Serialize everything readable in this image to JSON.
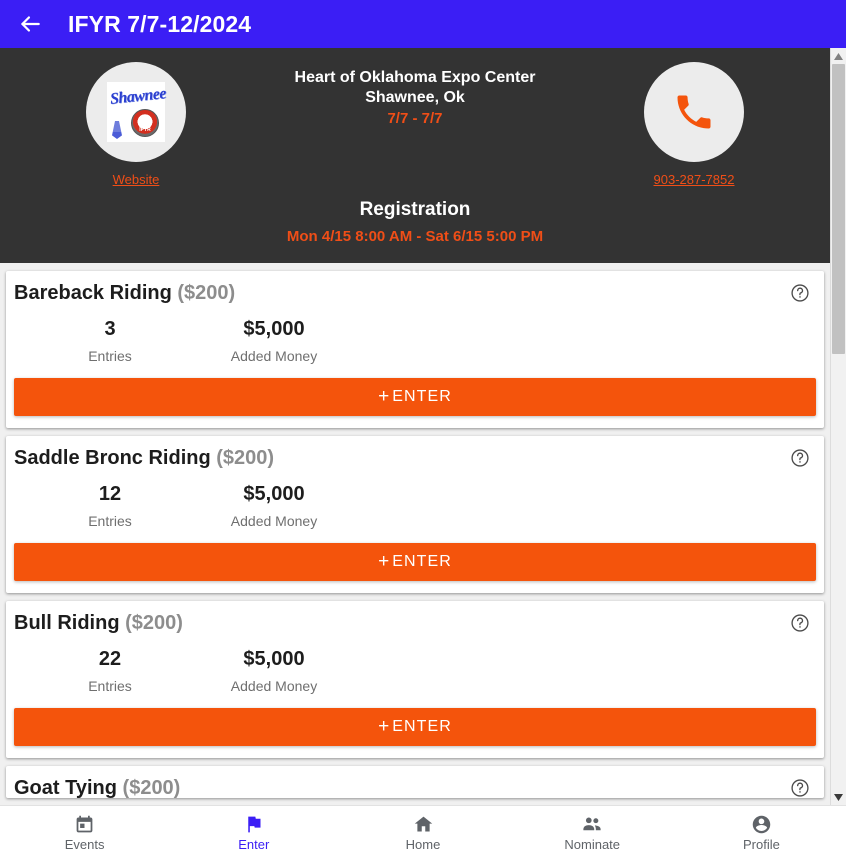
{
  "appbar": {
    "back_icon": "arrow-left-icon",
    "title": "IFYR 7/7-12/2024",
    "background_color": "#3b1ef5"
  },
  "event_header": {
    "background_color": "#333333",
    "accent_color": "#f04e17",
    "logo": {
      "icon": "shawnee-ifyr-logo",
      "text": "Shawnee",
      "emblem_text": "IFYR"
    },
    "website_link": "Website",
    "venue_name": "Heart of Oklahoma Expo Center",
    "venue_city": "Shawnee, Ok",
    "venue_dates": "7/7 - 7/7",
    "phone_icon": "phone-icon",
    "phone_number": "903-287-7852",
    "registration_title": "Registration",
    "registration_window": "Mon 4/15 8:00 AM - Sat 6/15 5:00 PM"
  },
  "cards": {
    "entries_label": "Entries",
    "added_money_label": "Added Money",
    "enter_label": "ENTER",
    "enter_plus": "+",
    "help_icon": "help-circle-icon",
    "button_color": "#f4540c",
    "items": [
      {
        "title": "Bareback Riding",
        "fee": "($200)",
        "entries": "3",
        "added_money": "$5,000"
      },
      {
        "title": "Saddle Bronc Riding",
        "fee": "($200)",
        "entries": "12",
        "added_money": "$5,000"
      },
      {
        "title": "Bull Riding",
        "fee": "($200)",
        "entries": "22",
        "added_money": "$5,000"
      },
      {
        "title": "Goat Tying",
        "fee": "($200)",
        "entries": "",
        "added_money": ""
      }
    ]
  },
  "bottom_nav": {
    "active_color": "#3b1ef5",
    "inactive_color": "#5f6368",
    "items": [
      {
        "label": "Events",
        "icon": "calendar-icon",
        "active": false
      },
      {
        "label": "Enter",
        "icon": "flag-icon",
        "active": true
      },
      {
        "label": "Home",
        "icon": "home-icon",
        "active": false
      },
      {
        "label": "Nominate",
        "icon": "people-icon",
        "active": false
      },
      {
        "label": "Profile",
        "icon": "account-circle-icon",
        "active": false
      }
    ]
  },
  "scrollbar": {
    "up_arrow_icon": "scroll-up-arrow-icon",
    "down_arrow_icon": "scroll-down-arrow-icon"
  }
}
